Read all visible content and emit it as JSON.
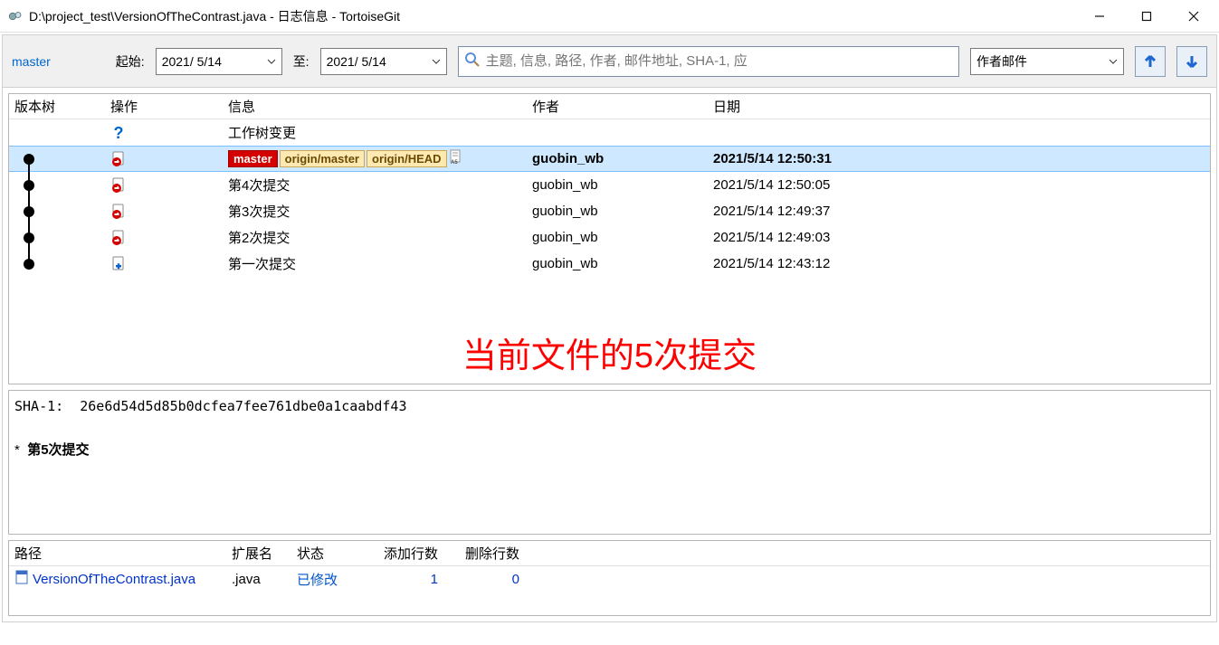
{
  "window": {
    "title": "D:\\project_test\\VersionOfTheContrast.java - 日志信息 - TortoiseGit"
  },
  "toolbar": {
    "branch": "master",
    "from_label": "起始:",
    "from_date": "2021/ 5/14",
    "to_label": "至:",
    "to_date": "2021/ 5/14",
    "search_placeholder": "主题, 信息, 路径, 作者, 邮件地址, SHA-1, 应",
    "filter_select": "作者邮件"
  },
  "log": {
    "columns": {
      "tree": "版本树",
      "op": "操作",
      "msg": "信息",
      "author": "作者",
      "date": "日期"
    },
    "worktree_msg": "工作树变更",
    "rows": [
      {
        "tags": [
          {
            "label": "master",
            "kind": "local"
          },
          {
            "label": "origin/master",
            "kind": "remote"
          },
          {
            "label": "origin/HEAD",
            "kind": "remote"
          }
        ],
        "msg": "",
        "author": "guobin_wb",
        "date": "2021/5/14 12:50:31",
        "selected": true
      },
      {
        "tags": [],
        "msg": "第4次提交",
        "author": "guobin_wb",
        "date": "2021/5/14 12:50:05",
        "selected": false
      },
      {
        "tags": [],
        "msg": "第3次提交",
        "author": "guobin_wb",
        "date": "2021/5/14 12:49:37",
        "selected": false
      },
      {
        "tags": [],
        "msg": "第2次提交",
        "author": "guobin_wb",
        "date": "2021/5/14 12:49:03",
        "selected": false
      },
      {
        "tags": [],
        "msg": "第一次提交",
        "author": "guobin_wb",
        "date": "2021/5/14 12:43:12",
        "selected": false
      }
    ],
    "annotation": "当前文件的5次提交"
  },
  "detail": {
    "sha_label": "SHA-1:",
    "sha": "26e6d54d5d85b0dcfea7fee761dbe0a1caabdf43",
    "bullet": "*",
    "title": "第5次提交"
  },
  "files": {
    "columns": {
      "path": "路径",
      "ext": "扩展名",
      "status": "状态",
      "add": "添加行数",
      "del": "删除行数"
    },
    "rows": [
      {
        "path": "VersionOfTheContrast.java",
        "ext": ".java",
        "status": "已修改",
        "add": "1",
        "del": "0"
      }
    ]
  }
}
